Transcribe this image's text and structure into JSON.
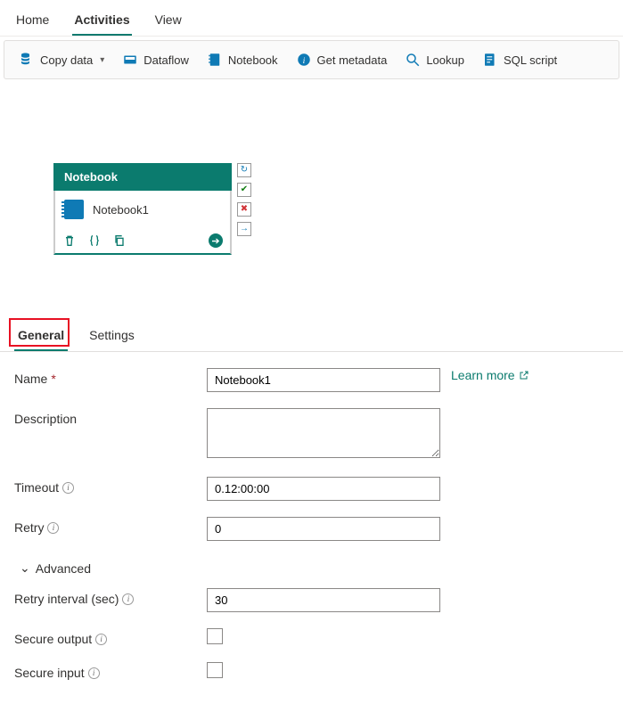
{
  "topTabs": {
    "home": "Home",
    "activities": "Activities",
    "view": "View"
  },
  "toolbar": {
    "copyData": "Copy data",
    "dataflow": "Dataflow",
    "notebook": "Notebook",
    "getMetadata": "Get metadata",
    "lookup": "Lookup",
    "sqlScript": "SQL script"
  },
  "node": {
    "type": "Notebook",
    "title": "Notebook1"
  },
  "propTabs": {
    "general": "General",
    "settings": "Settings"
  },
  "form": {
    "labels": {
      "name": "Name",
      "description": "Description",
      "timeout": "Timeout",
      "retry": "Retry",
      "advanced": "Advanced",
      "retryInterval": "Retry interval (sec)",
      "secureOutput": "Secure output",
      "secureInput": "Secure input"
    },
    "values": {
      "name": "Notebook1",
      "description": "",
      "timeout": "0.12:00:00",
      "retry": "0",
      "retryInterval": "30",
      "secureOutput": false,
      "secureInput": false
    },
    "learnMore": "Learn more"
  }
}
